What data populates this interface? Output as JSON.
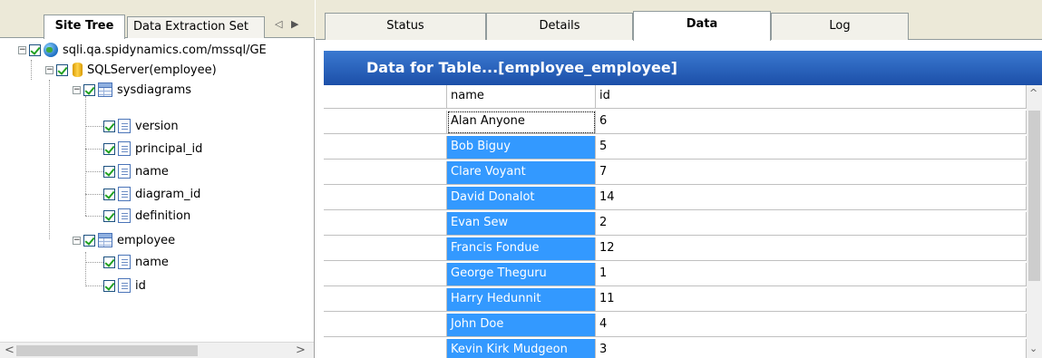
{
  "left_tabs": {
    "site_tree": "Site Tree",
    "data_extraction": "Data Extraction Set",
    "arrow_left": "◁",
    "arrow_right": "▶"
  },
  "tree": {
    "root": "sqli.qa.spidynamics.com/mssql/GE",
    "database": "SQLServer(employee)",
    "tables": [
      {
        "name": "sysdiagrams",
        "fields": [
          "version",
          "principal_id",
          "name",
          "diagram_id",
          "definition"
        ]
      },
      {
        "name": "employee",
        "fields": [
          "name",
          "id"
        ]
      }
    ],
    "expand_glyph": "−"
  },
  "left_scroll": {
    "left_arrow": "<",
    "right_arrow": ">"
  },
  "right_tabs": {
    "status": "Status",
    "details": "Details",
    "data": "Data",
    "log": "Log"
  },
  "data_panel": {
    "title": "Data for Table...[employee_employee]",
    "columns": [
      "name",
      "id"
    ],
    "rows": [
      {
        "name": "Alan Anyone",
        "id": "6"
      },
      {
        "name": "Bob Biguy",
        "id": "5"
      },
      {
        "name": "Clare Voyant",
        "id": "7"
      },
      {
        "name": "David Donalot",
        "id": "14"
      },
      {
        "name": "Evan Sew",
        "id": "2"
      },
      {
        "name": "Francis Fondue",
        "id": "12"
      },
      {
        "name": "George Theguru",
        "id": "1"
      },
      {
        "name": "Harry Hedunnit",
        "id": "11"
      },
      {
        "name": "John Doe",
        "id": "4"
      },
      {
        "name": "Kevin Kirk Mudgeon",
        "id": "3"
      }
    ]
  },
  "right_scroll": {
    "up_arrow": "^",
    "down_arrow": "⌄"
  },
  "colors": {
    "header_gradient_top": "#3a79d1",
    "header_gradient_bottom": "#1c4fa8",
    "selection": "#3399ff"
  }
}
